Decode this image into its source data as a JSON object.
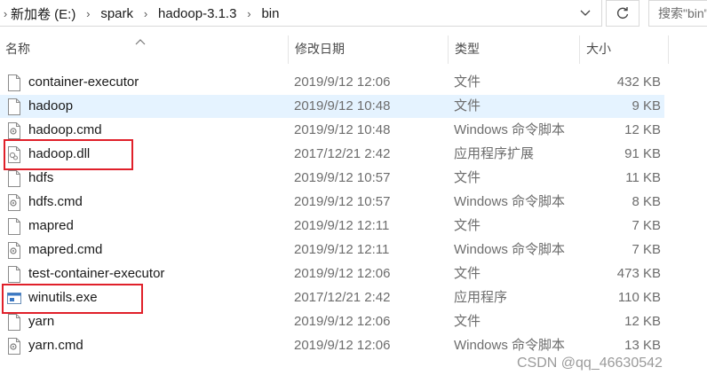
{
  "address_bar": {
    "crumbs": [
      "新加卷 (E:)",
      "spark",
      "hadoop-3.1.3",
      "bin"
    ],
    "search_placeholder": "搜索\"bin\""
  },
  "columns": {
    "name": "名称",
    "date": "修改日期",
    "type": "类型",
    "size": "大小"
  },
  "files": [
    {
      "name": "container-executor",
      "date": "2019/9/12 12:06",
      "type": "文件",
      "size": "432 KB",
      "icon": "file-icon"
    },
    {
      "name": "hadoop",
      "date": "2019/9/12 10:48",
      "type": "文件",
      "size": "9 KB",
      "icon": "file-icon"
    },
    {
      "name": "hadoop.cmd",
      "date": "2019/9/12 10:48",
      "type": "Windows 命令脚本",
      "size": "12 KB",
      "icon": "script-file-icon"
    },
    {
      "name": "hadoop.dll",
      "date": "2017/12/21 2:42",
      "type": "应用程序扩展",
      "size": "91 KB",
      "icon": "dll-file-icon"
    },
    {
      "name": "hdfs",
      "date": "2019/9/12 10:57",
      "type": "文件",
      "size": "11 KB",
      "icon": "file-icon"
    },
    {
      "name": "hdfs.cmd",
      "date": "2019/9/12 10:57",
      "type": "Windows 命令脚本",
      "size": "8 KB",
      "icon": "script-file-icon"
    },
    {
      "name": "mapred",
      "date": "2019/9/12 12:11",
      "type": "文件",
      "size": "7 KB",
      "icon": "file-icon"
    },
    {
      "name": "mapred.cmd",
      "date": "2019/9/12 12:11",
      "type": "Windows 命令脚本",
      "size": "7 KB",
      "icon": "script-file-icon"
    },
    {
      "name": "test-container-executor",
      "date": "2019/9/12 12:06",
      "type": "文件",
      "size": "473 KB",
      "icon": "file-icon"
    },
    {
      "name": "winutils.exe",
      "date": "2017/12/21 2:42",
      "type": "应用程序",
      "size": "110 KB",
      "icon": "exe-file-icon"
    },
    {
      "name": "yarn",
      "date": "2019/9/12 12:06",
      "type": "文件",
      "size": "12 KB",
      "icon": "file-icon"
    },
    {
      "name": "yarn.cmd",
      "date": "2019/9/12 12:06",
      "type": "Windows 命令脚本",
      "size": "13 KB",
      "icon": "script-file-icon"
    }
  ],
  "selected_file": "hadoop",
  "highlighted_files": [
    "hadoop.dll",
    "winutils.exe"
  ],
  "colors": {
    "selection": "#e5f3ff",
    "highlight_border": "#e0202a"
  },
  "watermark": "CSDN @qq_46630542"
}
